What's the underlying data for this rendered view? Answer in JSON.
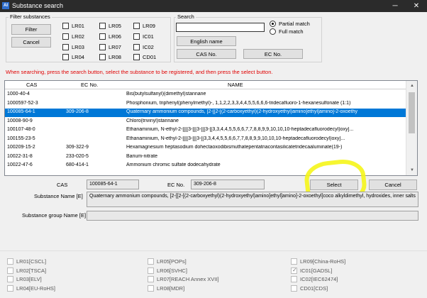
{
  "window": {
    "title": "Substance search",
    "icon": "AI",
    "minimize": "─",
    "close": "✕"
  },
  "filter": {
    "label": "Filter substances",
    "filter_button": "Filter",
    "cancel_button": "Cancel",
    "checkboxes": [
      {
        "label": "LR01",
        "checked": false
      },
      {
        "label": "LR02",
        "checked": false
      },
      {
        "label": "LR03",
        "checked": false
      },
      {
        "label": "LR04",
        "checked": false
      },
      {
        "label": "LR05",
        "checked": false
      },
      {
        "label": "LR06",
        "checked": false
      },
      {
        "label": "LR07",
        "checked": false
      },
      {
        "label": "LR08",
        "checked": false
      },
      {
        "label": "LR09",
        "checked": false
      },
      {
        "label": "IC01",
        "checked": false
      },
      {
        "label": "IC02",
        "checked": false
      },
      {
        "label": "CD01",
        "checked": false
      }
    ]
  },
  "search": {
    "label": "Search",
    "input_value": "",
    "partial_match": "Partial match",
    "full_match": "Full match",
    "english_name_button": "English name",
    "cas_button": "CAS No.",
    "ec_button": "EC No."
  },
  "notice": "When searching, press the search button, select the substance to be registered, and then press the select button.",
  "table": {
    "headers": [
      "CAS",
      "EC No.",
      "NAME"
    ],
    "rows": [
      {
        "cas": "1000-40-4",
        "ec": "",
        "name": "Bis(butylsulfanyl)(dimethyl)stannane",
        "selected": false
      },
      {
        "cas": "1000597-52-3",
        "ec": "",
        "name": "Phosphonium, triphenyl(phenylmethyl)-, 1,1,2,2,3,3,4,4,5,5,6,6,6-tridecafluoro-1-hexanesulfonate (1:1)",
        "selected": false
      },
      {
        "cas": "100085-64-1",
        "ec": "309-206-8",
        "name": "Quaternary ammonium compounds, [2-[[2-[(2-carboxyethyl)(2-hydroxyethyl)amino]ethyl]amino]-2-oxoethy",
        "selected": true
      },
      {
        "cas": "10008-90-9",
        "ec": "",
        "name": "Chloro(trivinyl)stannane",
        "selected": false
      },
      {
        "cas": "100107-48-0",
        "ec": "",
        "name": "Ethanaminium, N-ethyl-2-[[[[3-[[[3-[[[3-[[3,3,4,4,5,5,6,6,7,7,8,8,9,9,10,10,10-heptadecafluorodecyl)oxy]...",
        "selected": false
      },
      {
        "cas": "100155-23-5",
        "ec": "",
        "name": "Ethanaminium, N-ethyl-2-[[[[3-[[[3-[[3,3,4,4,5,5,6,6,7,7,8,8,9,9,10,10,10-heptadecafluorodecyl)oxy]...",
        "selected": false
      },
      {
        "cas": "100209-15-2",
        "ec": "309-322-9",
        "name": "Hexamagnesium heptasodium dohectaoxodibismuthatepentatriacontasilicatetridecaaluminate(19-)",
        "selected": false
      },
      {
        "cas": "10022-31-8",
        "ec": "233-020-5",
        "name": "Barium-nitrate",
        "selected": false
      },
      {
        "cas": "10022-47-6",
        "ec": "680-414-1",
        "name": "Ammonium chromic sulfate dodecahydrate",
        "selected": false
      }
    ]
  },
  "details": {
    "cas_label": "CAS",
    "cas_value": "100085-64-1",
    "ec_label": "EC No.",
    "ec_value": "309-206-8",
    "name_label": "Substance Name [E]",
    "name_value": "Quaternary ammonium compounds, [2-[[2-[(2-carboxyethyl)(2-hydroxyethyl)amino]ethyl]amino]-2-oxoethyl]coco alkyldimethyl, hydroxides, inner salts",
    "group_label": "Substance group Name [E]",
    "group_value": "",
    "select_button": "Select",
    "cancel_button": "Cancel"
  },
  "legislation": [
    {
      "label": "LR01[CSCL]",
      "checked": false
    },
    {
      "label": "LR02[TSCA]",
      "checked": false
    },
    {
      "label": "LR03[ELV]",
      "checked": false
    },
    {
      "label": "LR04[EU-RoHS]",
      "checked": false
    },
    {
      "label": "LR05[POPs]",
      "checked": false
    },
    {
      "label": "LR06[SVHC]",
      "checked": false
    },
    {
      "label": "LR07[REACH Annex XVII]",
      "checked": false
    },
    {
      "label": "LR08[MDR]",
      "checked": false
    },
    {
      "label": "LR09[China-RoHS]",
      "checked": false
    },
    {
      "label": "IC01[GADSL]",
      "checked": true
    },
    {
      "label": "IC02[IEC62474]",
      "checked": false
    },
    {
      "label": "CD01[CDS]",
      "checked": false
    }
  ],
  "colors": {
    "selection": "#0078d7",
    "notice": "#e00000",
    "highlight": "#f5f51a",
    "titlebar": "#2b2b2b"
  }
}
